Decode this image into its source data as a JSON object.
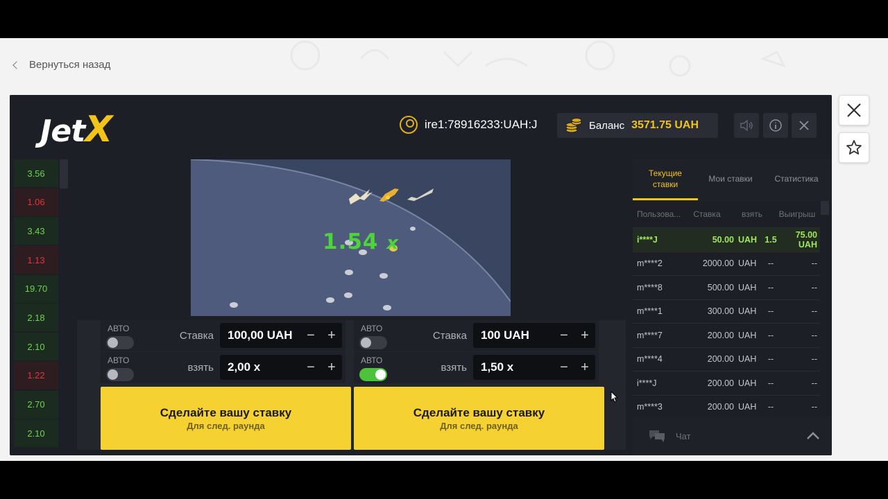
{
  "nav": {
    "back_label": "Вернуться назад"
  },
  "game": {
    "logo_main": "Jet",
    "logo_accent": "X",
    "username": "ire1:78916233:UAH:J",
    "balance_label": "Баланс",
    "balance_value": "3571.75 UAH",
    "multiplier": "1.54",
    "multiplier_suffix": "x"
  },
  "history": [
    {
      "value": "3.56",
      "status": "green"
    },
    {
      "value": "1.06",
      "status": "red"
    },
    {
      "value": "3.43",
      "status": "green"
    },
    {
      "value": "1.13",
      "status": "red"
    },
    {
      "value": "19.70",
      "status": "green"
    },
    {
      "value": "2.18",
      "status": "green"
    },
    {
      "value": "2.10",
      "status": "green"
    },
    {
      "value": "1.22",
      "status": "red"
    },
    {
      "value": "2.70",
      "status": "green"
    },
    {
      "value": "2.10",
      "status": "green"
    }
  ],
  "panels": [
    {
      "auto_label_1": "АВТО",
      "auto_on_1": false,
      "stake_label": "Ставка",
      "stake_value": "100,00 UAH",
      "auto_label_2": "АВТО",
      "auto_on_2": false,
      "take_label": "взять",
      "take_value": "2,00 x",
      "button_title": "Сделайте вашу ставку",
      "button_sub": "Для след. раунда"
    },
    {
      "auto_label_1": "АВТО",
      "auto_on_1": false,
      "stake_label": "Ставка",
      "stake_value": "100 UAH",
      "auto_label_2": "АВТО",
      "auto_on_2": true,
      "take_label": "взять",
      "take_value": "1,50 x",
      "button_title": "Сделайте вашу ставку",
      "button_sub": "Для след. раунда"
    }
  ],
  "steppers": {
    "minus": "−",
    "plus": "+"
  },
  "right": {
    "tabs": [
      "Текущие ставки",
      "Мои ставки",
      "Статистика"
    ],
    "columns": [
      "Пользова...",
      "Ставка",
      "взять",
      "Выигрыш"
    ],
    "bets": [
      {
        "user": "i****J",
        "bet": "50.00",
        "cur": "UAH",
        "take": "1.5",
        "win": "75.00  UAH",
        "won": true
      },
      {
        "user": "m****2",
        "bet": "2000.00",
        "cur": "UAH",
        "take": "--",
        "win": "--",
        "won": false
      },
      {
        "user": "m****8",
        "bet": "500.00",
        "cur": "UAH",
        "take": "--",
        "win": "--",
        "won": false
      },
      {
        "user": "m****1",
        "bet": "300.00",
        "cur": "UAH",
        "take": "--",
        "win": "--",
        "won": false
      },
      {
        "user": "m****7",
        "bet": "200.00",
        "cur": "UAH",
        "take": "--",
        "win": "--",
        "won": false
      },
      {
        "user": "m****4",
        "bet": "200.00",
        "cur": "UAH",
        "take": "--",
        "win": "--",
        "won": false
      },
      {
        "user": "i****J",
        "bet": "200.00",
        "cur": "UAH",
        "take": "--",
        "win": "--",
        "won": false
      },
      {
        "user": "m****3",
        "bet": "200.00",
        "cur": "UAH",
        "take": "--",
        "win": "--",
        "won": false
      }
    ],
    "chat_label": "Чат"
  },
  "colors": {
    "accent": "#f2c318",
    "win": "#4cd43a",
    "loss": "#e0363b"
  }
}
